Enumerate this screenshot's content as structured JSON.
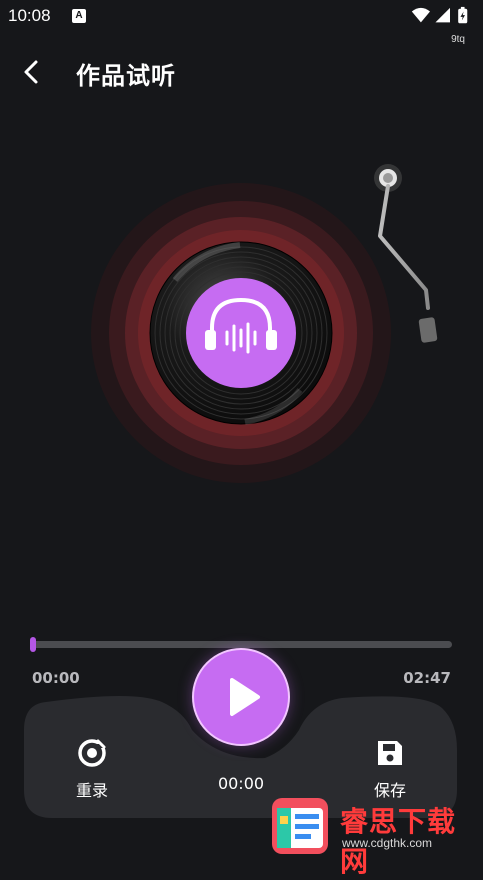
{
  "status_bar": {
    "time": "10:08",
    "notification_badge": "A",
    "carrier_sub": "9tq",
    "icons": [
      "wifi-icon",
      "signal-icon",
      "battery-charging-icon"
    ]
  },
  "header": {
    "title": "作品试听",
    "back_icon": "chevron-left-icon"
  },
  "player": {
    "center_icon": "headphones-icon",
    "accent_color": "#c66cf2"
  },
  "progress": {
    "value": 0.0,
    "current_time": "00:00",
    "total_time": "02:47"
  },
  "controls": {
    "rerecord_label": "重录",
    "save_label": "保存",
    "elapsed_time": "00:00",
    "play_icon": "play-icon",
    "rerecord_icon": "rerecord-icon",
    "save_icon": "floppy-disk-icon"
  },
  "watermark": {
    "text": "睿思下载网",
    "url": "www.cdgthk.com"
  }
}
